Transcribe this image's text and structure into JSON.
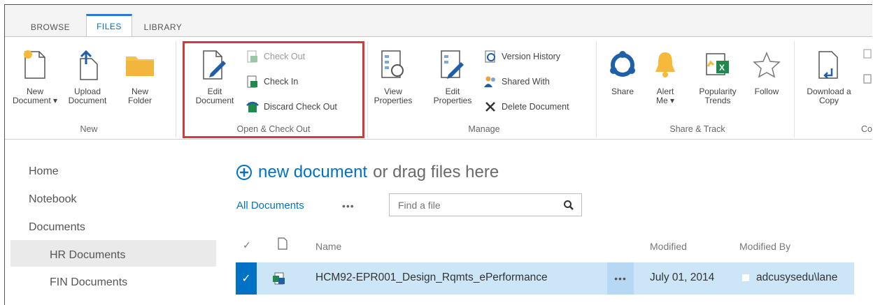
{
  "tabs": [
    {
      "label": "BROWSE"
    },
    {
      "label": "FILES"
    },
    {
      "label": "LIBRARY"
    }
  ],
  "ribbon": {
    "new_group": {
      "label": "New",
      "new_document": [
        "New",
        "Document ▾"
      ],
      "upload_document": [
        "Upload",
        "Document"
      ],
      "new_folder": [
        "New",
        "Folder"
      ]
    },
    "open_group": {
      "label": "Open & Check Out",
      "edit_document": [
        "Edit",
        "Document"
      ],
      "check_out": "Check Out",
      "check_in": "Check In",
      "discard_check_out": "Discard Check Out"
    },
    "manage_group": {
      "label": "Manage",
      "view_properties": [
        "View",
        "Properties"
      ],
      "edit_properties": [
        "Edit",
        "Properties"
      ],
      "version_history": "Version History",
      "shared_with": "Shared With",
      "delete_document": "Delete Document"
    },
    "share_group": {
      "label": "Share & Track",
      "share": [
        "Share"
      ],
      "alert_me": [
        "Alert",
        "Me ▾"
      ],
      "popularity_trends": [
        "Popularity",
        "Trends"
      ],
      "follow": [
        "Follow"
      ]
    },
    "copies_group": {
      "label": "Co",
      "download_copy": [
        "Download a",
        "Copy"
      ]
    }
  },
  "nav": {
    "items": [
      "Home",
      "Notebook",
      "Documents"
    ],
    "sub_items": [
      "HR Documents",
      "FIN Documents"
    ]
  },
  "main": {
    "new_document_link": "new document",
    "new_document_suffix": "or drag files here",
    "view_name": "All Documents",
    "more": "•••",
    "search_placeholder": "Find a file",
    "columns": {
      "name": "Name",
      "modified": "Modified",
      "modified_by": "Modified By"
    },
    "rows": [
      {
        "name": "HCM92-EPR001_Design_Rqmts_ePerformance",
        "modified": "July 01, 2014",
        "modified_by": "adcusysedu\\lane",
        "selected": true
      }
    ]
  },
  "colors": {
    "accent": "#0072c6",
    "highlight_box": "#d9363e",
    "selected_row": "#cde6f7"
  }
}
